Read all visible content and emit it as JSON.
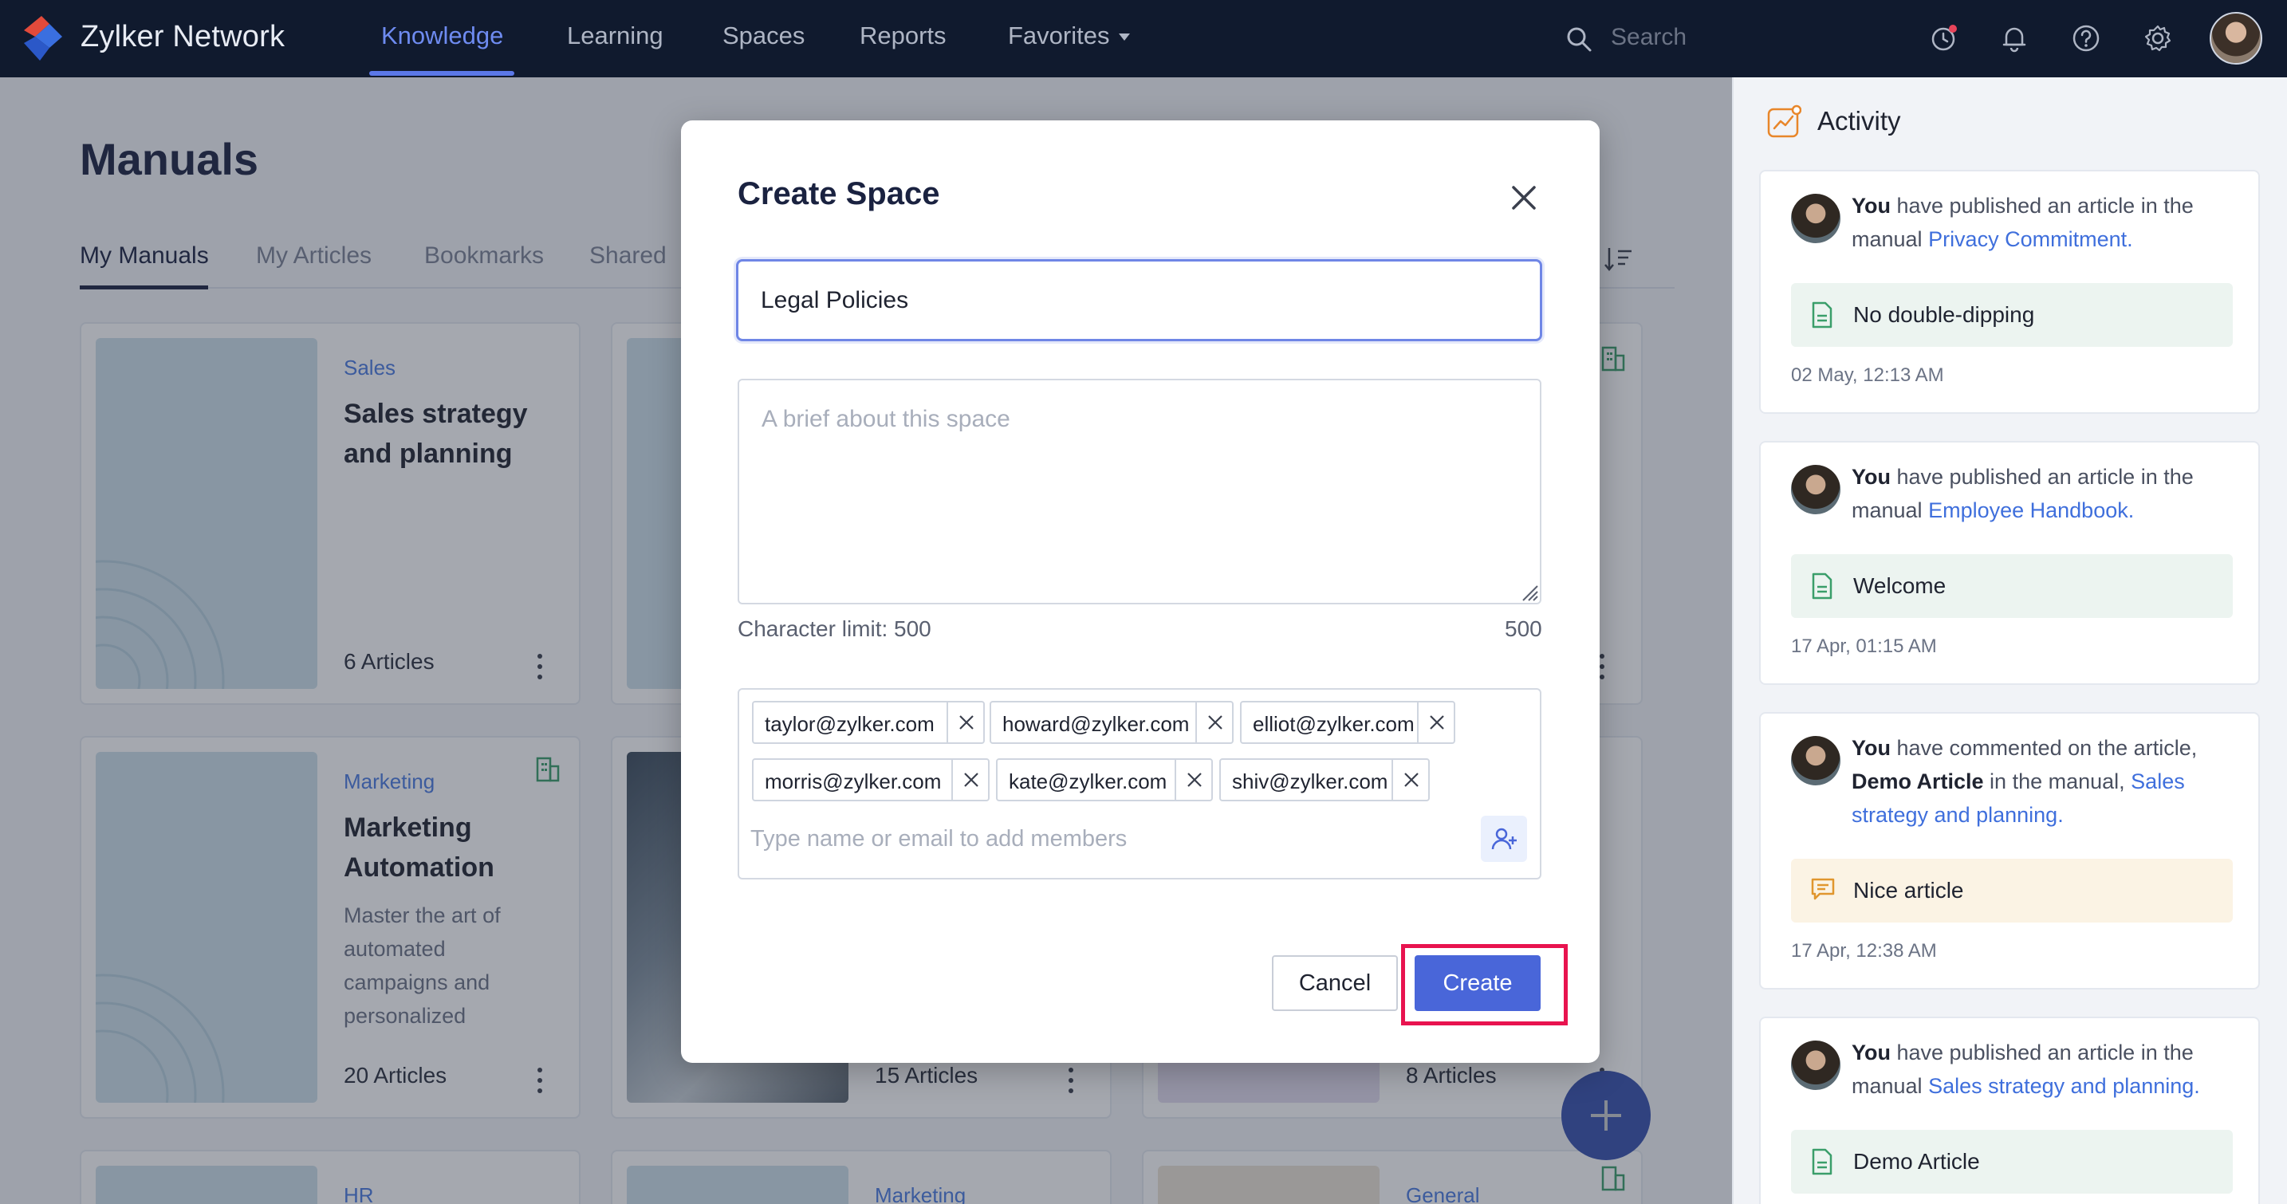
{
  "brand": {
    "name": "Zylker Network"
  },
  "nav": {
    "items": [
      {
        "label": "Knowledge",
        "active": true
      },
      {
        "label": "Learning"
      },
      {
        "label": "Spaces"
      },
      {
        "label": "Reports"
      },
      {
        "label": "Favorites",
        "has_dropdown": true
      }
    ],
    "search_placeholder": "Search",
    "icons": [
      "clock-icon",
      "bell-icon",
      "help-icon",
      "gear-icon",
      "user-avatar"
    ]
  },
  "page": {
    "title": "Manuals",
    "tabs": [
      {
        "label": "My Manuals",
        "active": true
      },
      {
        "label": "My Articles"
      },
      {
        "label": "Bookmarks"
      },
      {
        "label": "Shared"
      }
    ]
  },
  "cards": [
    {
      "category": "Sales",
      "title": "Sales strategy and planning",
      "count": "6 Articles"
    },
    {
      "category": "Marketing",
      "title": "Marketing Automation",
      "description": "Master the art of automated campaigns and personalized",
      "count": "20 Articles"
    },
    {
      "count": "15 Articles"
    },
    {
      "count": "8 Articles"
    },
    {
      "category": "HR"
    },
    {
      "category": "Marketing"
    },
    {
      "category": "General"
    }
  ],
  "activity": {
    "title": "Activity",
    "items": [
      {
        "actor": "You",
        "text": " have published an article in the manual ",
        "link": "Privacy Commitment",
        "suffix": ".",
        "pill": "No double-dipping",
        "time": "02 May, 12:13 AM"
      },
      {
        "actor": "You",
        "text": " have published an article in the manual ",
        "link": "Employee Handbook",
        "suffix": ".",
        "pill": "Welcome",
        "time": "17 Apr, 01:15 AM"
      },
      {
        "actor": "You",
        "text": " have commented on the article, ",
        "bold2": "Demo Article",
        "text2": " in the manual, ",
        "link": "Sales strategy and planning",
        "suffix": ".",
        "pill": "Nice article",
        "time": "17 Apr, 12:38 AM"
      },
      {
        "actor": "You",
        "text": " have published an article in the manual ",
        "link": "Sales strategy and planning",
        "suffix": ".",
        "pill": "Demo Article"
      }
    ]
  },
  "modal": {
    "title": "Create Space",
    "name_value": "Legal Policies",
    "brief_placeholder": "A brief about this space",
    "char_limit_label": "Character limit: 500",
    "char_remaining": "500",
    "members": [
      "taylor@zylker.com",
      "howard@zylker.com",
      "elliot@zylker.com",
      "morris@zylker.com",
      "kate@zylker.com",
      "shiv@zylker.com"
    ],
    "member_placeholder": "Type name or email to add members",
    "cancel_label": "Cancel",
    "create_label": "Create"
  },
  "colors": {
    "accent": "#4966d9",
    "topbar": "#101a2e",
    "highlight": "#e8134f",
    "link": "#3f6fdc"
  }
}
